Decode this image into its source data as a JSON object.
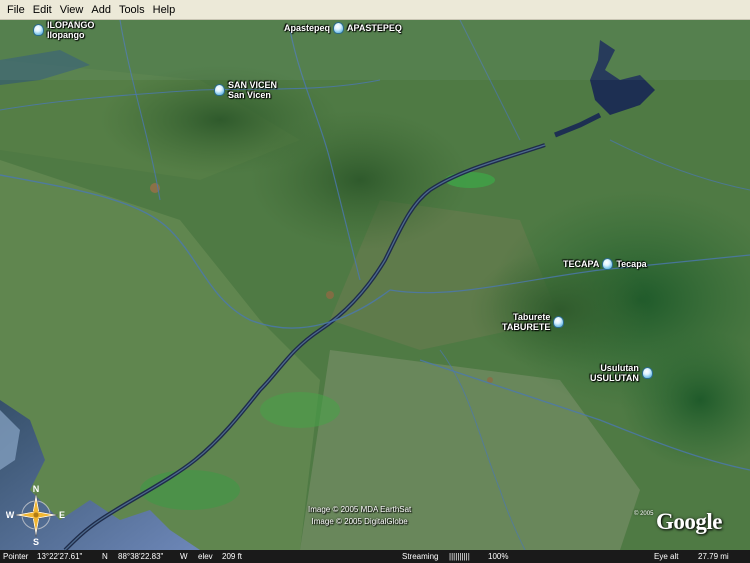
{
  "menu": [
    "File",
    "Edit",
    "View",
    "Add",
    "Tools",
    "Help"
  ],
  "placemarks": [
    {
      "id": "ilopango",
      "line1": "ILOPANGO",
      "line2": "Ilopango"
    },
    {
      "id": "apastepeq",
      "line1": "Apastepeq",
      "line2": "APASTEPEQ"
    },
    {
      "id": "sanvicen",
      "line1": "SAN VICEN",
      "line2": "San Vicen"
    },
    {
      "id": "tecapa",
      "line1": "TECAPA",
      "line2": "Tecapa"
    },
    {
      "id": "taburete",
      "line1": "Taburete",
      "line2": "TABURETE"
    },
    {
      "id": "usulutan",
      "line1": "Usulutan",
      "line2": "USULUTAN"
    }
  ],
  "compass": {
    "n": "N",
    "s": "S",
    "e": "E",
    "w": "W"
  },
  "credits": [
    "Image © 2005 MDA EarthSat",
    "Image © 2005 DigitalGlobe"
  ],
  "logo": {
    "copyright": "© 2005",
    "text": "Google"
  },
  "status": {
    "pointer_label": "Pointer",
    "lat": "13°22'27.61\"",
    "lat_dir": "N",
    "lon": "88°38'22.83\"",
    "lon_dir": "W",
    "elev_label": "elev",
    "elev": "209 ft",
    "streaming_label": "Streaming",
    "streaming_bar": "||||||||||",
    "streaming_pct": "100%",
    "eye_label": "Eye alt",
    "eye_alt": "27.79 mi"
  }
}
